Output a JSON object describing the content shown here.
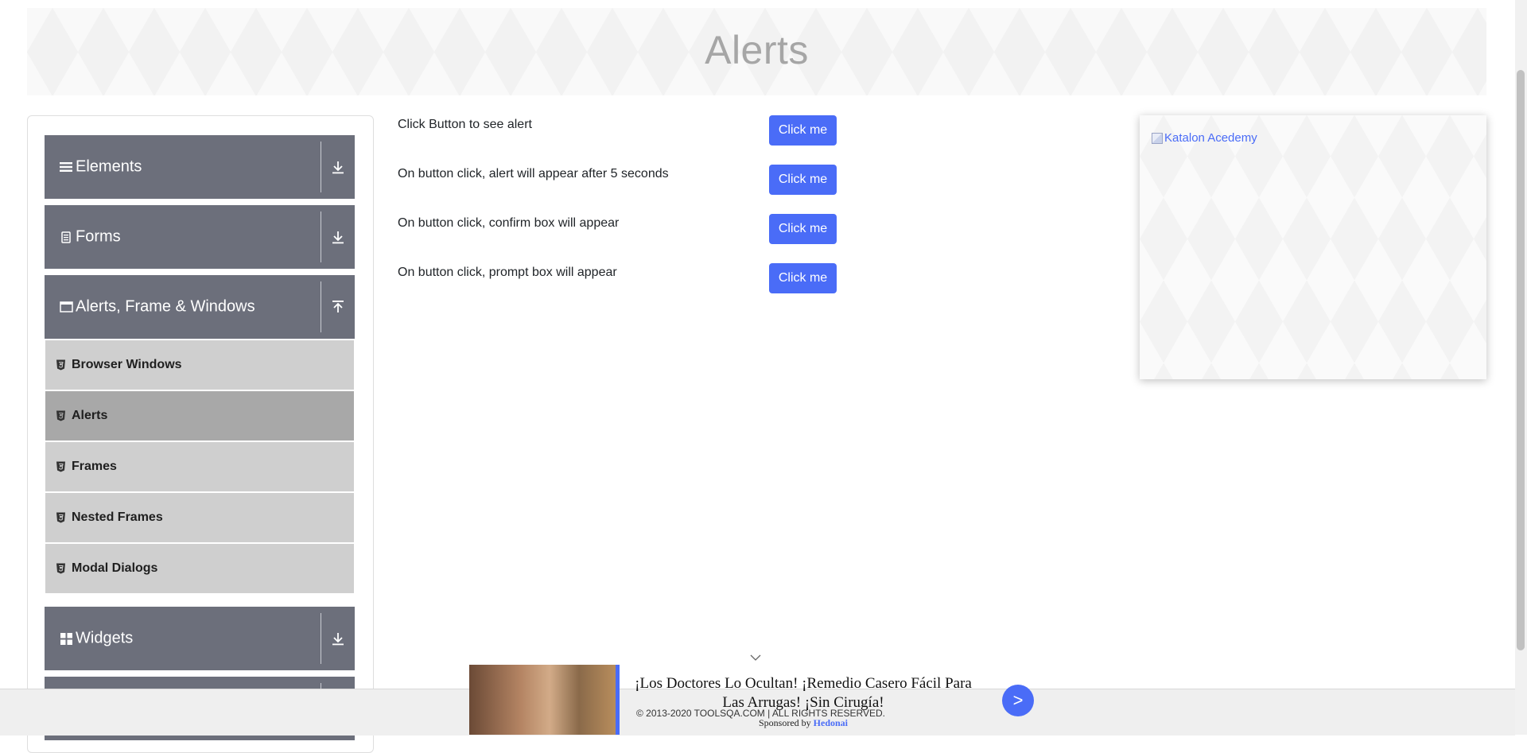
{
  "header": {
    "title": "Alerts"
  },
  "sidebar": {
    "groups": [
      {
        "label": "Elements",
        "icon": "hamburger-icon",
        "arrow": "download-arrow-icon"
      },
      {
        "label": "Forms",
        "icon": "document-icon",
        "arrow": "download-arrow-icon"
      },
      {
        "label": "Alerts, Frame & Windows",
        "icon": "window-icon",
        "arrow": "upload-arrow-icon"
      },
      {
        "label": "Widgets",
        "icon": "grid-icon",
        "arrow": "download-arrow-icon"
      }
    ],
    "sub_items": [
      {
        "label": "Browser Windows",
        "active": false
      },
      {
        "label": "Alerts",
        "active": true
      },
      {
        "label": "Frames",
        "active": false
      },
      {
        "label": "Nested Frames",
        "active": false
      },
      {
        "label": "Modal Dialogs",
        "active": false
      }
    ]
  },
  "main": {
    "rows": [
      {
        "label": "Click Button to see alert",
        "button": "Click me"
      },
      {
        "label": "On button click, alert will appear after 5 seconds",
        "button": "Click me"
      },
      {
        "label": "On button click, confirm box will appear",
        "button": "Click me"
      },
      {
        "label": "On button click, prompt box will appear",
        "button": "Click me"
      }
    ]
  },
  "ad_side": {
    "link_text": "Katalon Acedemy"
  },
  "footer": {
    "copyright": "© 2013-2020 TOOLSQA.COM | ALL RIGHTS RESERVED."
  },
  "ad_banner": {
    "headline": "¡Los Doctores Lo Ocultan! ¡Remedio Casero Fácil Para Las Arrugas! ¡Sin Cirugía!",
    "sponsor_prefix": "Sponsored by",
    "sponsor_name": "Hedonai",
    "next_label": ">"
  },
  "colors": {
    "accent": "#4a6cf7",
    "sidebar_header": "#6c6f7b",
    "sub_item": "#cfcfcf",
    "sub_item_active": "#a8a8a8"
  }
}
